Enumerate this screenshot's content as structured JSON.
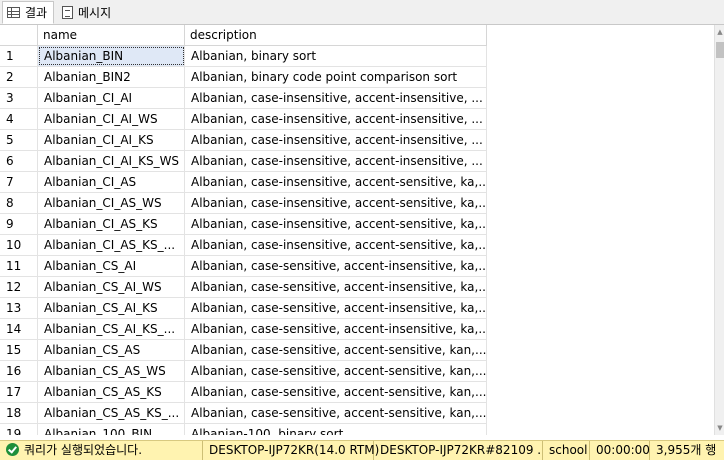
{
  "tabs": [
    {
      "label": "결과",
      "icon": "grid-icon",
      "active": true
    },
    {
      "label": "메시지",
      "icon": "message-icon",
      "active": false
    }
  ],
  "grid": {
    "columns": [
      "name",
      "description"
    ],
    "selected_row": 1,
    "rows": [
      {
        "num": "1",
        "name": "Albanian_BIN",
        "description": "Albanian, binary sort"
      },
      {
        "num": "2",
        "name": "Albanian_BIN2",
        "description": "Albanian, binary code point comparison sort"
      },
      {
        "num": "3",
        "name": "Albanian_CI_AI",
        "description": "Albanian, case-insensitive, accent-insensitive, ..."
      },
      {
        "num": "4",
        "name": "Albanian_CI_AI_WS",
        "description": "Albanian, case-insensitive, accent-insensitive, ..."
      },
      {
        "num": "5",
        "name": "Albanian_CI_AI_KS",
        "description": "Albanian, case-insensitive, accent-insensitive, ..."
      },
      {
        "num": "6",
        "name": "Albanian_CI_AI_KS_WS",
        "description": "Albanian, case-insensitive, accent-insensitive, ..."
      },
      {
        "num": "7",
        "name": "Albanian_CI_AS",
        "description": "Albanian, case-insensitive, accent-sensitive, ka,..."
      },
      {
        "num": "8",
        "name": "Albanian_CI_AS_WS",
        "description": "Albanian, case-insensitive, accent-sensitive, ka,..."
      },
      {
        "num": "9",
        "name": "Albanian_CI_AS_KS",
        "description": "Albanian, case-insensitive, accent-sensitive, ka,..."
      },
      {
        "num": "10",
        "name": "Albanian_CI_AS_KS_...",
        "description": "Albanian, case-insensitive, accent-sensitive, ka,..."
      },
      {
        "num": "11",
        "name": "Albanian_CS_AI",
        "description": "Albanian, case-sensitive, accent-insensitive, ka,..."
      },
      {
        "num": "12",
        "name": "Albanian_CS_AI_WS",
        "description": "Albanian, case-sensitive, accent-insensitive, ka,..."
      },
      {
        "num": "13",
        "name": "Albanian_CS_AI_KS",
        "description": "Albanian, case-sensitive, accent-insensitive, ka,..."
      },
      {
        "num": "14",
        "name": "Albanian_CS_AI_KS_...",
        "description": "Albanian, case-sensitive, accent-insensitive, ka,..."
      },
      {
        "num": "15",
        "name": "Albanian_CS_AS",
        "description": "Albanian, case-sensitive, accent-sensitive, kan,..."
      },
      {
        "num": "16",
        "name": "Albanian_CS_AS_WS",
        "description": "Albanian, case-sensitive, accent-sensitive, kan,..."
      },
      {
        "num": "17",
        "name": "Albanian_CS_AS_KS",
        "description": "Albanian, case-sensitive, accent-sensitive, kan,..."
      },
      {
        "num": "18",
        "name": "Albanian_CS_AS_KS_...",
        "description": "Albanian, case-sensitive, accent-sensitive, kan,..."
      },
      {
        "num": "19",
        "name": "Albanian_100_BIN",
        "description": "Albanian-100, binary sort"
      }
    ]
  },
  "status": {
    "icon": "check-circle-icon",
    "message": "쿼리가 실행되었습니다.",
    "server": "DESKTOP-IJP72KR(14.0 RTM)",
    "user": "DESKTOP-IJP72KR#82109 ...",
    "database": "school",
    "elapsed": "00:00:00",
    "row_count": "3,955개 행",
    "bg_color": "#fff3b0"
  }
}
